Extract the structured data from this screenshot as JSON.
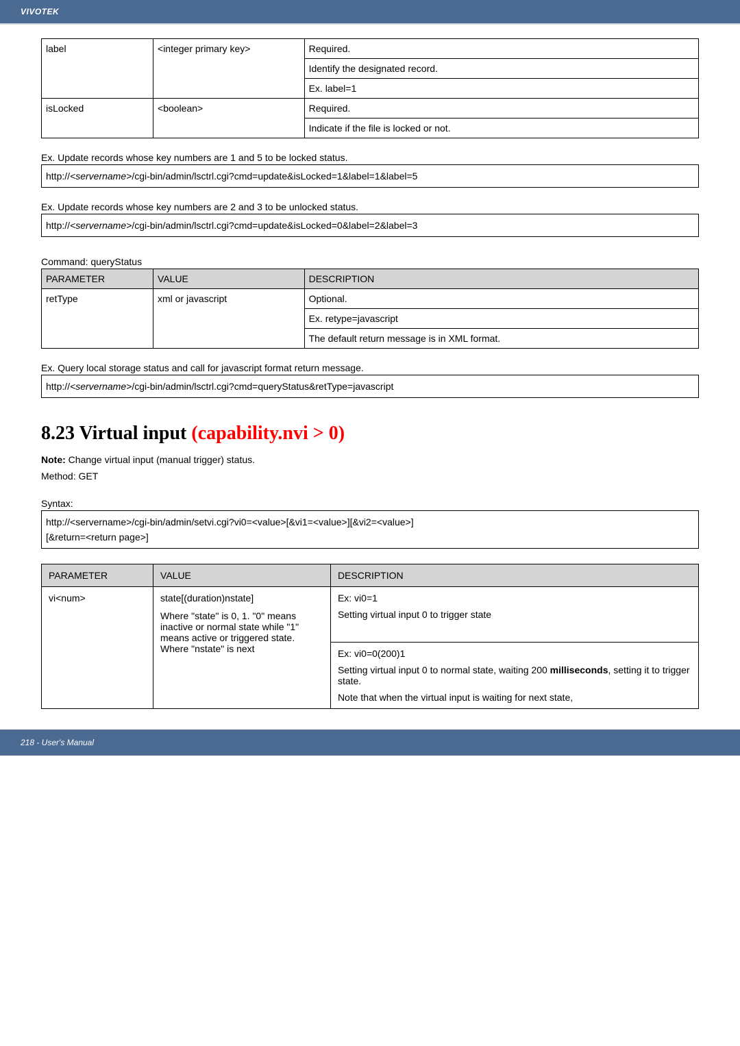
{
  "header": {
    "brand": "VIVOTEK"
  },
  "table1": {
    "rows": [
      {
        "param": "label",
        "value": "<integer primary key>",
        "desc": [
          "Required.",
          "Identify the designated record.",
          "Ex. label=1"
        ]
      },
      {
        "param": "isLocked",
        "value": "<boolean>",
        "desc": [
          "Required.",
          "Indicate if the file is locked or not."
        ]
      }
    ]
  },
  "ex1": {
    "text": "Ex. Update records whose key numbers are 1 and 5 to be locked status.",
    "url_prefix": "http://",
    "url_server": "<servername>",
    "url_rest": "/cgi-bin/admin/lsctrl.cgi?cmd=update&isLocked=1&label=1&label=5"
  },
  "ex2": {
    "text": "Ex. Update records whose key numbers are 2 and 3 to be unlocked status.",
    "url_prefix": "http://",
    "url_server": "<servername>",
    "url_rest": "/cgi-bin/admin/lsctrl.cgi?cmd=update&isLocked=0&label=2&label=3"
  },
  "command": {
    "label": "Command: queryStatus"
  },
  "table2": {
    "headers": [
      "PARAMETER",
      "VALUE",
      "DESCRIPTION"
    ],
    "rows": [
      {
        "param": "retType",
        "value": "xml or javascript",
        "desc": [
          "Optional.",
          "Ex. retype=javascript",
          "The default return message is in XML format."
        ]
      }
    ]
  },
  "ex3": {
    "text": "Ex. Query local storage status and call for javascript format return message.",
    "url_prefix": "http://",
    "url_server": "<servername>",
    "url_rest": "/cgi-bin/admin/lsctrl.cgi?cmd=queryStatus&retType=javascript"
  },
  "section": {
    "number_title": "8.23 Virtual input ",
    "red_part": "(capability.nvi > 0)"
  },
  "note": {
    "label": "Note:",
    "text": " Change virtual input (manual trigger) status."
  },
  "method": "Method: GET",
  "syntax": {
    "label": "Syntax:",
    "line1": "http://<servername>/cgi-bin/admin/setvi.cgi?vi0=<value>[&vi1=<value>][&vi2=<value>]",
    "line2": "[&return=<return page>]"
  },
  "table3": {
    "headers": [
      "PARAMETER",
      "VALUE",
      "DESCRIPTION"
    ],
    "row": {
      "param": "vi<num>",
      "value_lines": [
        "state[(duration)nstate]",
        "",
        "Where \"state\" is 0, 1. \"0\" means inactive or normal state while \"1\" means active or triggered state. Where \"nstate\" is next"
      ],
      "desc1": [
        "Ex: vi0=1",
        "Setting virtual input 0 to trigger state"
      ],
      "desc2_plain1": "Ex: vi0=0(200)1",
      "desc2_plain2": "Setting virtual input 0 to normal state, waiting 200 ",
      "desc2_bold": "milliseconds",
      "desc2_after": ", setting it to trigger state.",
      "desc2_plain3": "Note that when the virtual input is waiting for next state,"
    }
  },
  "footer": {
    "text": "218 - User's Manual"
  }
}
